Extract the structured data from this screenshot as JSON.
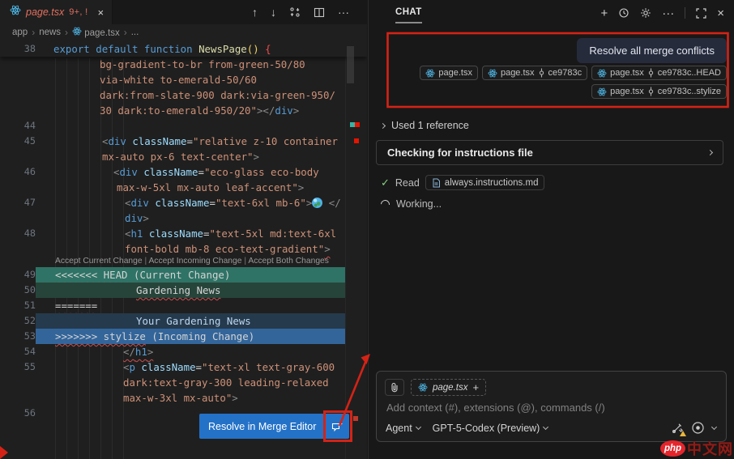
{
  "colors": {
    "accent_blue": "#2472c8",
    "annotation_red": "#d42316",
    "merge_current_header": "#2f7366",
    "merge_current_content": "#27443a",
    "merge_incoming_content": "#253a4c",
    "merge_incoming_header": "#33659a",
    "error_red": "#f14c4c",
    "string_orange": "#ce9178",
    "tag_blue": "#569cd6"
  },
  "editor": {
    "tab": {
      "file": "page.tsx",
      "decoration": "9+, !",
      "close_glyph": "×"
    },
    "toolbar": {
      "up": "↑",
      "down": "↓",
      "more": "···"
    },
    "breadcrumb": [
      {
        "label": "app"
      },
      {
        "label": "news"
      },
      {
        "label": "page.tsx",
        "icon": "react"
      },
      {
        "label": "..."
      }
    ],
    "sticky": {
      "n": "38",
      "pad": 10,
      "segs": [
        {
          "t": "export",
          "c": "kw"
        },
        {
          "t": " "
        },
        {
          "t": "default",
          "c": "kw"
        },
        {
          "t": " "
        },
        {
          "t": "function",
          "c": "kw"
        },
        {
          "t": " "
        },
        {
          "t": "NewsPage",
          "c": "fn"
        },
        {
          "t": "()",
          "c": "par"
        },
        {
          "t": " "
        },
        {
          "t": "{",
          "c": "brr"
        }
      ]
    },
    "codelens": [
      "Accept Current Change",
      "Accept Incoming Change",
      "Accept Both Changes"
    ],
    "lines": [
      {
        "pad": 67,
        "segs": [
          {
            "t": "bg-gradient-to-br from-green-50/80",
            "c": "str"
          }
        ]
      },
      {
        "pad": 67,
        "segs": [
          {
            "t": "via-white to-emerald-50/60",
            "c": "str"
          }
        ]
      },
      {
        "pad": 67,
        "segs": [
          {
            "t": "dark:from-slate-900 dark:via-green-950/",
            "c": "str"
          }
        ]
      },
      {
        "pad": 67,
        "segs": [
          {
            "t": "30 dark:to-emerald-950/20\"",
            "c": "str"
          },
          {
            "t": "></",
            "c": "pun"
          },
          {
            "t": "div",
            "c": "tag"
          },
          {
            "t": ">",
            "c": "pun"
          }
        ]
      },
      {
        "n": "44",
        "pad": 0,
        "segs": []
      },
      {
        "n": "45",
        "pad": 70,
        "segs": [
          {
            "t": "<",
            "c": "pun"
          },
          {
            "t": "div",
            "c": "tag"
          },
          {
            "t": " "
          },
          {
            "t": "className",
            "c": "attr"
          },
          {
            "t": "=",
            "c": "op"
          },
          {
            "t": "\"relative z-10 container",
            "c": "str"
          }
        ]
      },
      {
        "pad": 70,
        "segs": [
          {
            "t": "mx-auto px-6 text-center\"",
            "c": "str"
          },
          {
            "t": ">",
            "c": "pun"
          }
        ]
      },
      {
        "n": "46",
        "pad": 84,
        "segs": [
          {
            "t": "<",
            "c": "pun"
          },
          {
            "t": "div",
            "c": "tag"
          },
          {
            "t": " "
          },
          {
            "t": "className",
            "c": "attr"
          },
          {
            "t": "=",
            "c": "op"
          },
          {
            "t": "\"eco-glass eco-body",
            "c": "str"
          }
        ]
      },
      {
        "pad": 88,
        "segs": [
          {
            "t": "max-w-5xl mx-auto leaf-accent\"",
            "c": "str"
          },
          {
            "t": ">",
            "c": "pun"
          }
        ]
      },
      {
        "n": "47",
        "pad": 98,
        "segs": [
          {
            "t": "<",
            "c": "pun"
          },
          {
            "t": "div",
            "c": "tag"
          },
          {
            "t": " "
          },
          {
            "t": "className",
            "c": "attr"
          },
          {
            "t": "=",
            "c": "op"
          },
          {
            "t": "\"text-6xl mb-6\"",
            "c": "str"
          },
          {
            "t": ">",
            "c": "pun"
          },
          {
            "g": true
          },
          {
            "t": " </",
            "c": "pun"
          }
        ]
      },
      {
        "pad": 98,
        "segs": [
          {
            "t": "div",
            "c": "tag"
          },
          {
            "t": ">",
            "c": "pun"
          }
        ]
      },
      {
        "n": "48",
        "pad": 98,
        "segs": [
          {
            "t": "<",
            "c": "pun"
          },
          {
            "t": "h1",
            "c": "tag"
          },
          {
            "t": " "
          },
          {
            "t": "className",
            "c": "attr"
          },
          {
            "t": "=",
            "c": "op"
          },
          {
            "t": "\"text-5xl md:text-6xl",
            "c": "str"
          }
        ]
      },
      {
        "pad": 98,
        "segs": [
          {
            "t": "font-bold mb-8 eco-text-gradient\"",
            "c": "str"
          },
          {
            "t": ">",
            "c": "pun sq"
          }
        ]
      },
      {
        "type": "lens"
      },
      {
        "n": "49",
        "cls": "bg-curhead",
        "pad": 12,
        "segs": [
          {
            "t": "<<<<<<< HEAD",
            "c": "txt sq"
          },
          {
            "t": " (Current Change)",
            "c": "txt"
          }
        ]
      },
      {
        "n": "50",
        "cls": "bg-curbody",
        "pad": 112,
        "segs": [
          {
            "t": "Gardening News",
            "c": "txt sq"
          }
        ]
      },
      {
        "n": "51",
        "pad": 12,
        "segs": [
          {
            "t": "=======",
            "c": "txt sq"
          }
        ]
      },
      {
        "n": "52",
        "cls": "bg-incbody",
        "pad": 112,
        "segs": [
          {
            "t": "Your Gardening News",
            "c": "txt2"
          }
        ]
      },
      {
        "n": "53",
        "cls": "bg-inchead",
        "pad": 12,
        "segs": [
          {
            "t": ">>>>>>> stylize",
            "c": "txt sq"
          },
          {
            "t": " (Incoming Change)",
            "c": "txt"
          }
        ]
      },
      {
        "n": "54",
        "pad": 96,
        "segs": [
          {
            "t": "</",
            "c": "pun sq"
          },
          {
            "t": "h1",
            "c": "tag sq"
          },
          {
            "t": ">",
            "c": "pun sq"
          }
        ]
      },
      {
        "n": "55",
        "pad": 96,
        "segs": [
          {
            "t": "<",
            "c": "pun"
          },
          {
            "t": "p",
            "c": "tag"
          },
          {
            "t": " "
          },
          {
            "t": "className",
            "c": "attr"
          },
          {
            "t": "=",
            "c": "op"
          },
          {
            "t": "\"text-xl text-gray-600",
            "c": "str"
          }
        ]
      },
      {
        "pad": 96,
        "segs": [
          {
            "t": "dark:text-gray-300 leading-relaxed",
            "c": "str"
          }
        ]
      },
      {
        "pad": 96,
        "segs": [
          {
            "t": "max-w-3xl mx-auto\"",
            "c": "str"
          },
          {
            "t": ">",
            "c": "pun"
          }
        ]
      },
      {
        "n": "56",
        "pad": 0,
        "segs": []
      }
    ],
    "resolve_button": {
      "label": "Resolve in Merge Editor"
    }
  },
  "chat": {
    "title": "CHAT",
    "header": {
      "new_chat": "+",
      "more": "···",
      "close": "×"
    },
    "request": {
      "message": "Resolve all merge conflicts",
      "chips": [
        {
          "file": "page.tsx"
        },
        {
          "file": "page.tsx",
          "ref": "ce9783c"
        },
        {
          "file": "page.tsx",
          "ref": "ce9783c..HEAD"
        },
        {
          "file": "page.tsx",
          "ref": "ce9783c..stylize"
        }
      ]
    },
    "used_reference": "Used 1 reference",
    "progress": "Checking for instructions file",
    "read": {
      "label": "Read",
      "file": "always.instructions.md"
    },
    "working": "Working...",
    "input": {
      "attached_file": "page.tsx",
      "add": "+",
      "placeholder": "Add context (#), extensions (@), commands (/)",
      "agent": "Agent",
      "model": "GPT-5-Codex (Preview)"
    },
    "watermark": {
      "brand": "php",
      "text": "中文网"
    }
  }
}
